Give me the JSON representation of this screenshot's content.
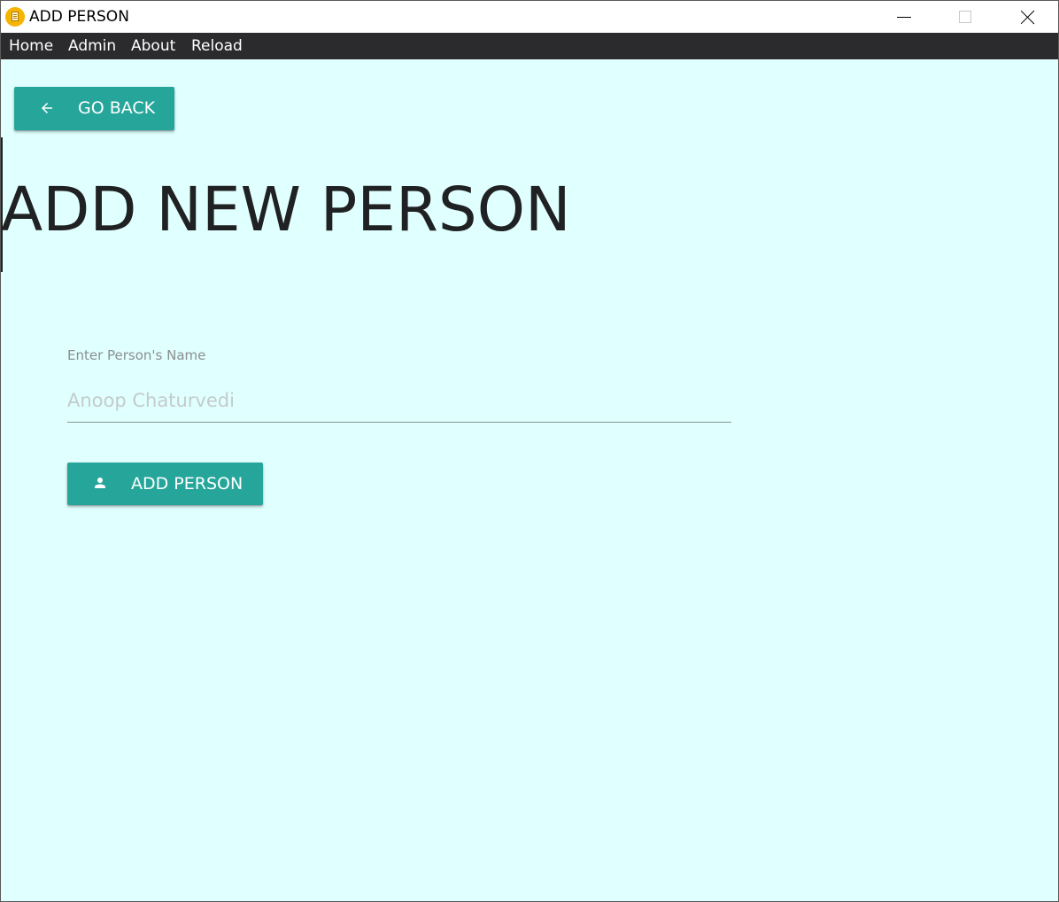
{
  "window": {
    "title": "ADD PERSON",
    "icon": "app-notepad-icon"
  },
  "menu": {
    "items": [
      {
        "label": "Home"
      },
      {
        "label": "Admin"
      },
      {
        "label": "About"
      },
      {
        "label": "Reload"
      }
    ]
  },
  "back_button": {
    "label": "GO BACK",
    "icon": "arrow-left-icon"
  },
  "page": {
    "title": "ADD NEW PERSON"
  },
  "form": {
    "name_label": "Enter Person's Name",
    "name_placeholder": "Anoop Chaturvedi",
    "name_value": ""
  },
  "add_button": {
    "label": "ADD PERSON",
    "icon": "person-icon"
  },
  "colors": {
    "background": "#e0ffff",
    "accent": "#26a69a",
    "menubar": "#2b2b2e",
    "app_icon": "#f5b400"
  }
}
